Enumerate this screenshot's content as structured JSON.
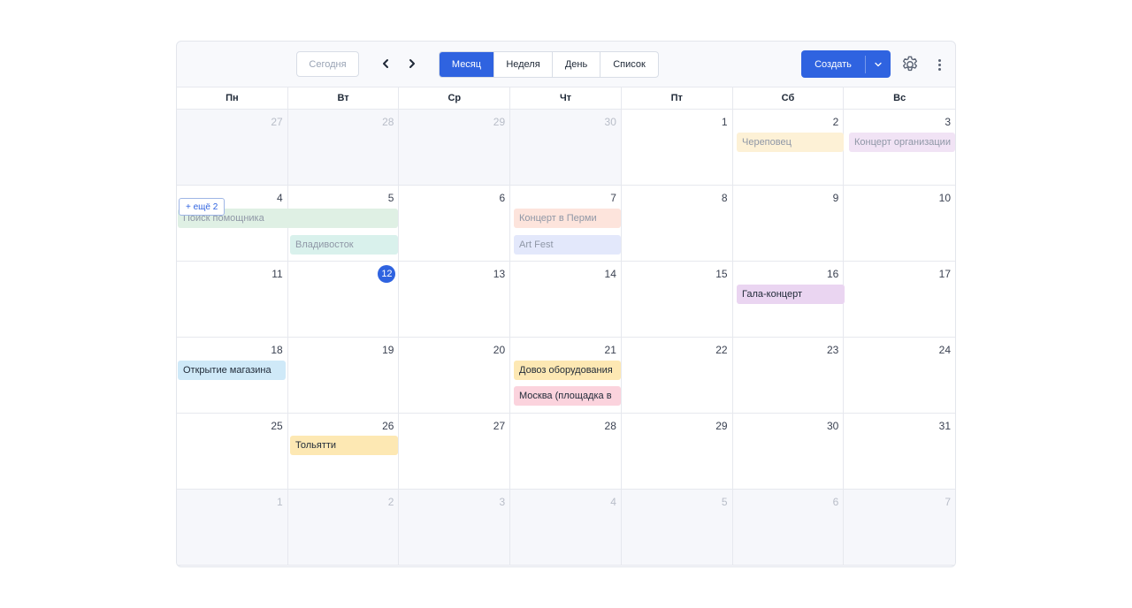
{
  "toolbar": {
    "today_label": "Сегодня",
    "prev_icon": "chevron-left-icon",
    "next_icon": "chevron-right-icon",
    "views": [
      {
        "label": "Месяц",
        "active": true
      },
      {
        "label": "Неделя",
        "active": false
      },
      {
        "label": "День",
        "active": false
      },
      {
        "label": "Список",
        "active": false
      }
    ],
    "create_label": "Создать",
    "create_dropdown_icon": "chevron-down-icon",
    "settings_icon": "gear-icon",
    "more_icon": "kebab-menu-icon"
  },
  "weekdays": [
    "Пн",
    "Вт",
    "Ср",
    "Чт",
    "Пт",
    "Сб",
    "Вс"
  ],
  "weeks": [
    [
      {
        "day": "27",
        "outside": true
      },
      {
        "day": "28",
        "outside": true
      },
      {
        "day": "29",
        "outside": true
      },
      {
        "day": "30",
        "outside": true
      },
      {
        "day": "1",
        "outside": false
      },
      {
        "day": "2",
        "outside": false
      },
      {
        "day": "3",
        "outside": false
      }
    ],
    [
      {
        "day": "4",
        "outside": false
      },
      {
        "day": "5",
        "outside": false
      },
      {
        "day": "6",
        "outside": false
      },
      {
        "day": "7",
        "outside": false
      },
      {
        "day": "8",
        "outside": false
      },
      {
        "day": "9",
        "outside": false
      },
      {
        "day": "10",
        "outside": false
      }
    ],
    [
      {
        "day": "11",
        "outside": false
      },
      {
        "day": "12",
        "outside": false,
        "today": true
      },
      {
        "day": "13",
        "outside": false
      },
      {
        "day": "14",
        "outside": false
      },
      {
        "day": "15",
        "outside": false
      },
      {
        "day": "16",
        "outside": false
      },
      {
        "day": "17",
        "outside": false
      }
    ],
    [
      {
        "day": "18",
        "outside": false
      },
      {
        "day": "19",
        "outside": false
      },
      {
        "day": "20",
        "outside": false
      },
      {
        "day": "21",
        "outside": false
      },
      {
        "day": "22",
        "outside": false
      },
      {
        "day": "23",
        "outside": false
      },
      {
        "day": "24",
        "outside": false
      }
    ],
    [
      {
        "day": "25",
        "outside": false
      },
      {
        "day": "26",
        "outside": false
      },
      {
        "day": "27",
        "outside": false
      },
      {
        "day": "28",
        "outside": false
      },
      {
        "day": "29",
        "outside": false
      },
      {
        "day": "30",
        "outside": false
      },
      {
        "day": "31",
        "outside": false
      }
    ],
    [
      {
        "day": "1",
        "outside": true
      },
      {
        "day": "2",
        "outside": true
      },
      {
        "day": "3",
        "outside": true
      },
      {
        "day": "4",
        "outside": true
      },
      {
        "day": "5",
        "outside": true
      },
      {
        "day": "6",
        "outside": true
      },
      {
        "day": "7",
        "outside": true
      }
    ]
  ],
  "events": [
    {
      "title": "Череповец",
      "color": "#fdf1d6",
      "faded": true
    },
    {
      "title": "Концерт организации",
      "color": "#f1e3f5",
      "faded": true
    },
    {
      "title": "Поиск помощника",
      "color": "#dff0e4",
      "faded": true
    },
    {
      "title": "Владивосток",
      "color": "#d9f1ec",
      "faded": true
    },
    {
      "title": "Концерт в Перми",
      "color": "#fde4dc",
      "faded": true
    },
    {
      "title": "Art Fest",
      "color": "#e3e8fb",
      "faded": true
    },
    {
      "title": "Гала-концерт",
      "color": "#ead5f1",
      "faded": false
    },
    {
      "title": "Открытие магазина",
      "color": "#cfe9f8",
      "faded": false
    },
    {
      "title": "Довоз оборудования",
      "color": "#fde8b3",
      "faded": false
    },
    {
      "title": "Москва (площадка в",
      "color": "#fbd3dd",
      "faded": false
    },
    {
      "title": "Тольятти",
      "color": "#fde8b3",
      "faded": false
    }
  ],
  "more_link_label": "+ ещё 2"
}
